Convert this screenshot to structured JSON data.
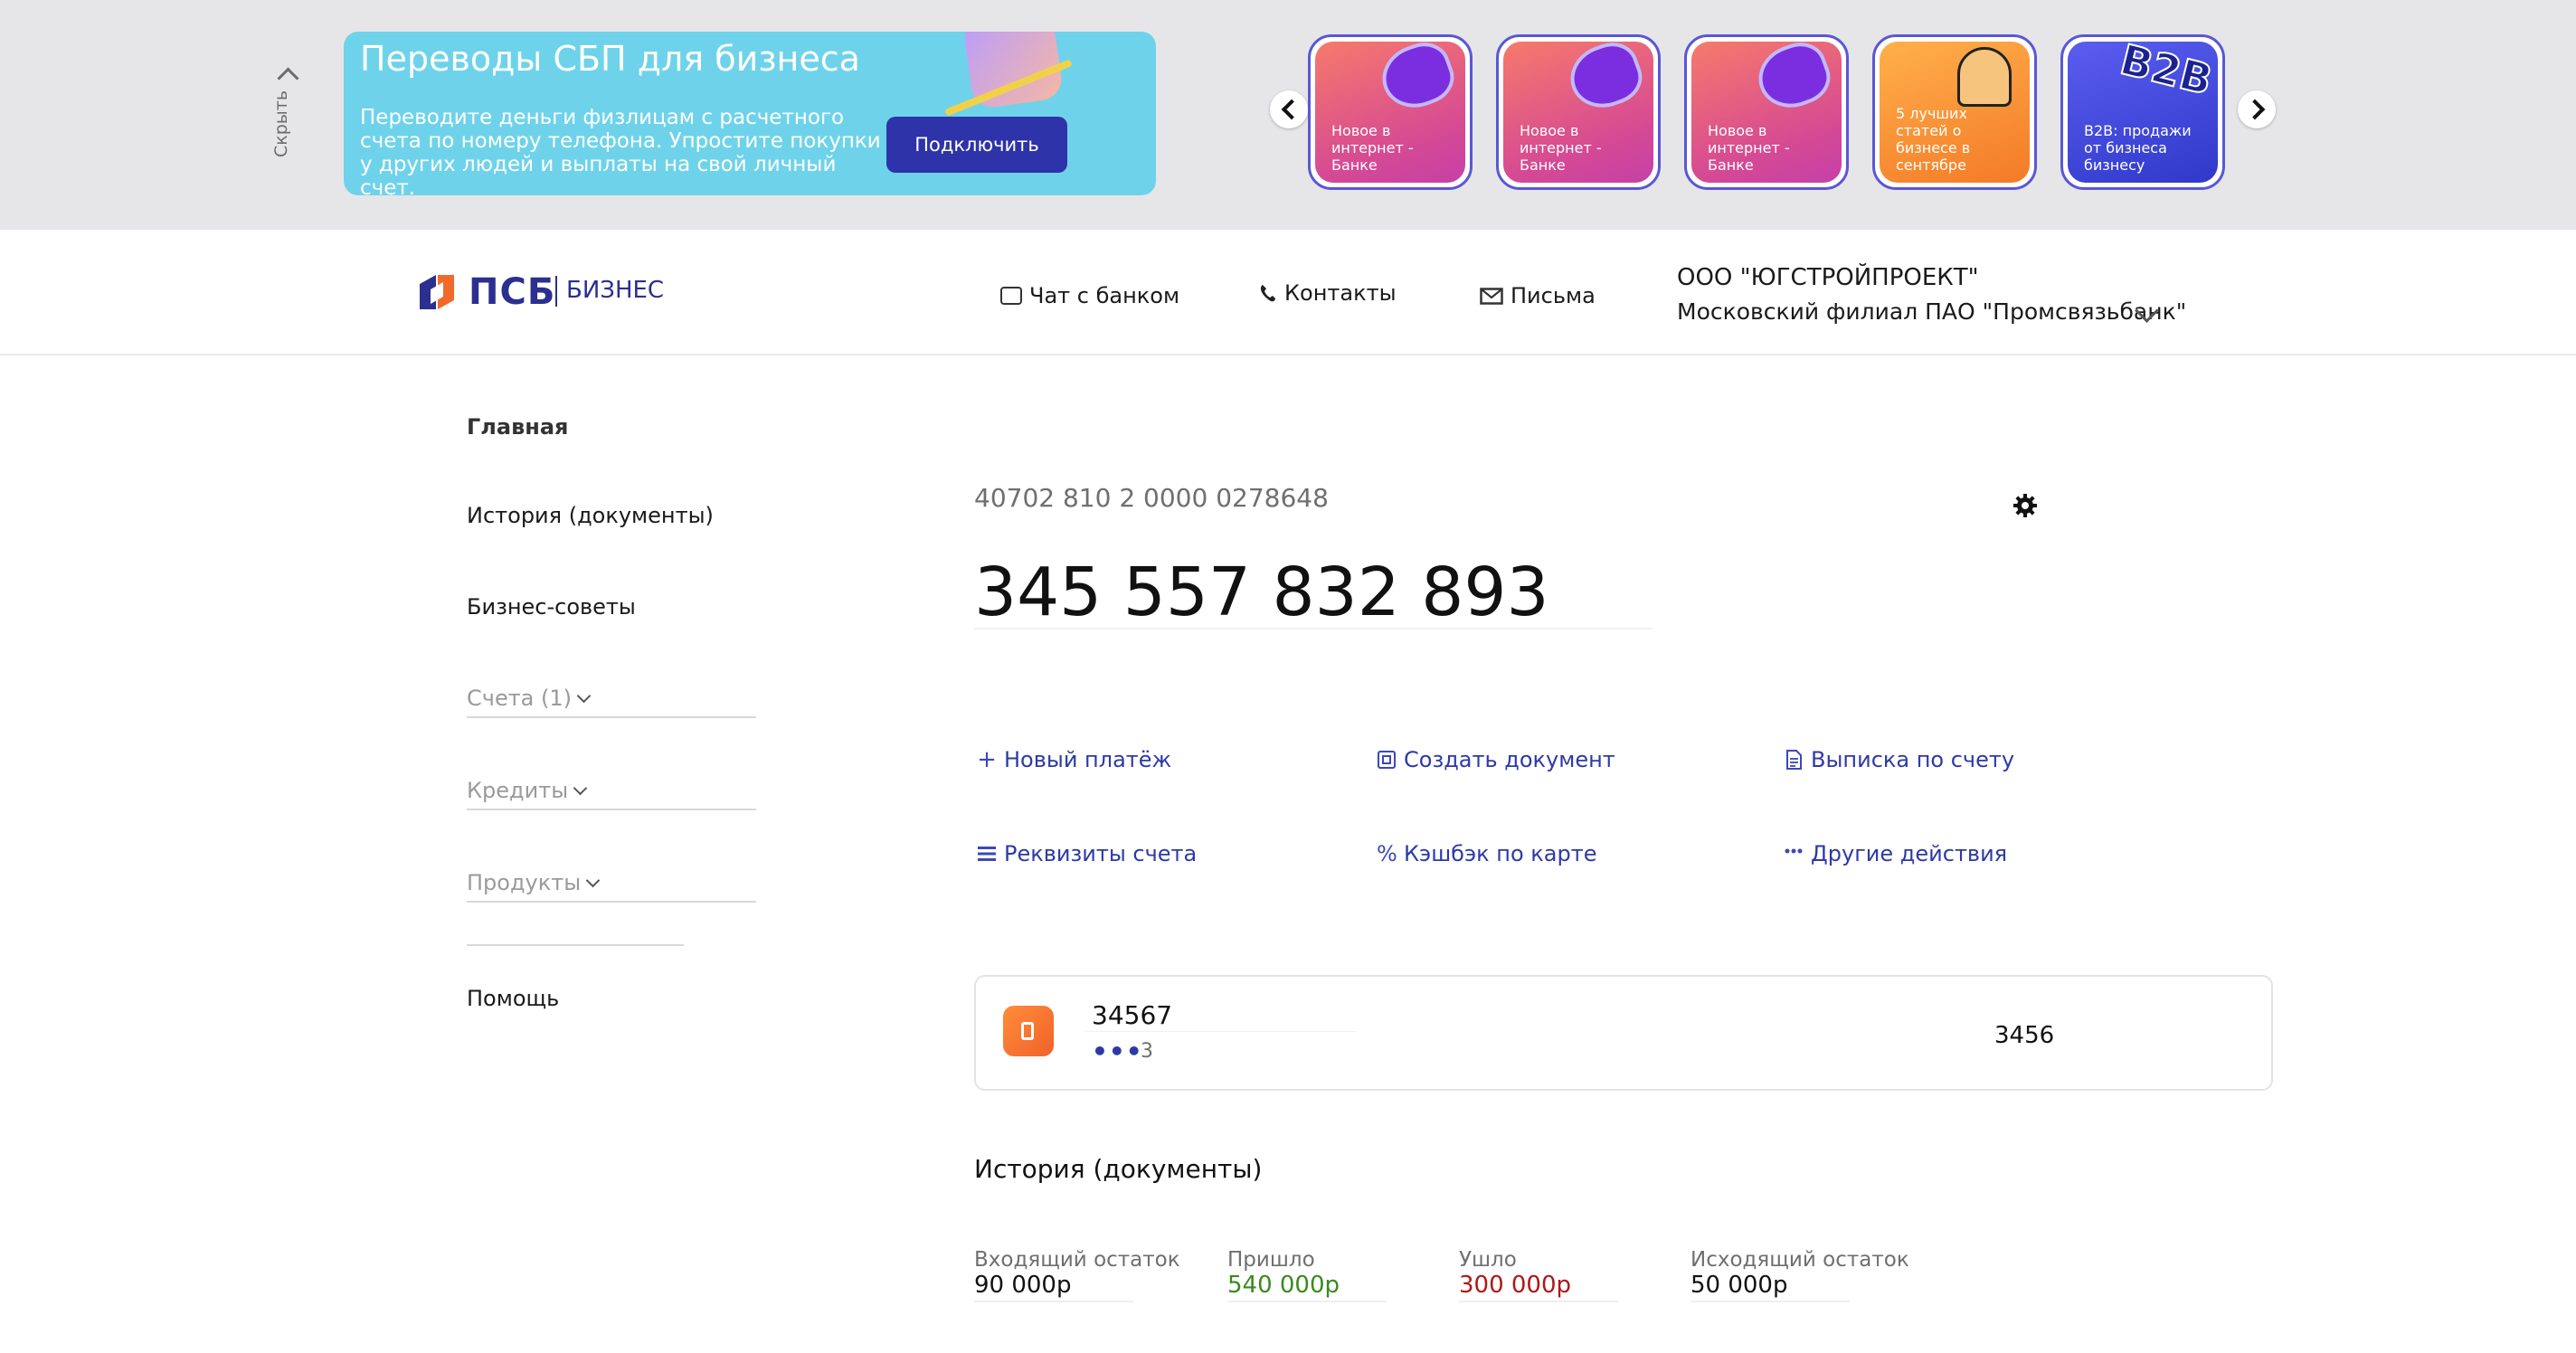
{
  "promo": {
    "hide_label": "Скрыть",
    "banner": {
      "title": "Переводы СБП для бизнеса",
      "text": "Переводите деньги физлицам с расчетного счета по номеру телефона. Упростите покупки у других людей и выплаты на свой личный счет.",
      "button": "Подключить"
    },
    "stories": [
      {
        "label": "Новое в интернет - Банке"
      },
      {
        "label": "Новое в интернет - Банке"
      },
      {
        "label": "Новое в интернет - Банке"
      },
      {
        "label": "5 лучших статей о бизнесе в сентябре"
      },
      {
        "label": "B2B: продажи от бизнеса бизнесу",
        "art_text": "B2B"
      }
    ]
  },
  "header": {
    "logo_text": "ПСБ",
    "logo_sub": "БИЗНЕС",
    "chat": "Чат с банком",
    "contacts": "Контакты",
    "letters": "Письма",
    "org_name": "ООО \"ЮГСТРОЙПРОЕКТ\"",
    "org_branch": "Московский филиал ПАО \"Промсвязьбанк\""
  },
  "sidebar": {
    "main": "Главная",
    "history": "История (документы)",
    "tips": "Бизнес-советы",
    "accounts": "Счета (1)",
    "credits": "Кредиты",
    "products": "Продукты",
    "help": "Помощь"
  },
  "account": {
    "number": "40702 810 2 0000 0278648",
    "balance": "345 557 832 893"
  },
  "actions": {
    "new_payment": "Новый платёж",
    "create_doc": "Создать документ",
    "statement": "Выписка по счету",
    "requisites": "Реквизиты счета",
    "cashback": "Кэшбэк по карте",
    "other": "Другие действия"
  },
  "card": {
    "title": "34567",
    "dots": "•••",
    "sub": "3",
    "amount": "3456"
  },
  "history": {
    "title": "История (документы)",
    "stats": [
      {
        "label": "Входящий остаток",
        "value": "90 000р"
      },
      {
        "label": "Пришло",
        "value": "540 000р"
      },
      {
        "label": "Ушло",
        "value": "300 000р"
      },
      {
        "label": "Исходящий остаток",
        "value": "50 000р"
      }
    ]
  },
  "colors": {
    "brand": "#2b2f8f",
    "link": "#2d3aa6",
    "income": "#3b8a1e",
    "outgo": "#b01818"
  }
}
